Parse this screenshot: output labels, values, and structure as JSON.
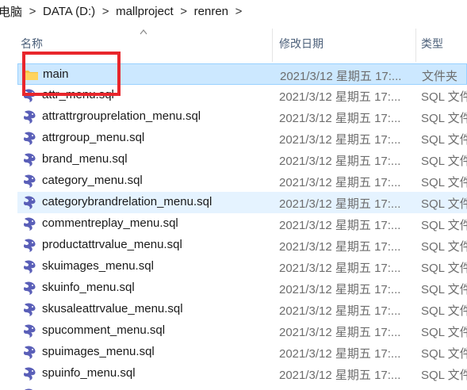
{
  "address": {
    "crumbs": [
      "电脑",
      "DATA (D:)",
      "mallproject",
      "renren"
    ],
    "separator": ">"
  },
  "columns": {
    "name": "名称",
    "date": "修改日期",
    "type": "类型"
  },
  "files": [
    {
      "name": "main",
      "date": "2021/3/12 星期五 17:...",
      "type": "文件夹",
      "icon": "folder-icon"
    },
    {
      "name": "attr_menu.sql",
      "date": "2021/3/12 星期五 17:...",
      "type": "SQL 文件",
      "icon": "sql-file-icon"
    },
    {
      "name": "attrattrgrouprelation_menu.sql",
      "date": "2021/3/12 星期五 17:...",
      "type": "SQL 文件",
      "icon": "sql-file-icon"
    },
    {
      "name": "attrgroup_menu.sql",
      "date": "2021/3/12 星期五 17:...",
      "type": "SQL 文件",
      "icon": "sql-file-icon"
    },
    {
      "name": "brand_menu.sql",
      "date": "2021/3/12 星期五 17:...",
      "type": "SQL 文件",
      "icon": "sql-file-icon"
    },
    {
      "name": "category_menu.sql",
      "date": "2021/3/12 星期五 17:...",
      "type": "SQL 文件",
      "icon": "sql-file-icon"
    },
    {
      "name": "categorybrandrelation_menu.sql",
      "date": "2021/3/12 星期五 17:...",
      "type": "SQL 文件",
      "icon": "sql-file-icon"
    },
    {
      "name": "commentreplay_menu.sql",
      "date": "2021/3/12 星期五 17:...",
      "type": "SQL 文件",
      "icon": "sql-file-icon"
    },
    {
      "name": "productattrvalue_menu.sql",
      "date": "2021/3/12 星期五 17:...",
      "type": "SQL 文件",
      "icon": "sql-file-icon"
    },
    {
      "name": "skuimages_menu.sql",
      "date": "2021/3/12 星期五 17:...",
      "type": "SQL 文件",
      "icon": "sql-file-icon"
    },
    {
      "name": "skuinfo_menu.sql",
      "date": "2021/3/12 星期五 17:...",
      "type": "SQL 文件",
      "icon": "sql-file-icon"
    },
    {
      "name": "skusaleattrvalue_menu.sql",
      "date": "2021/3/12 星期五 17:...",
      "type": "SQL 文件",
      "icon": "sql-file-icon"
    },
    {
      "name": "spucomment_menu.sql",
      "date": "2021/3/12 星期五 17:...",
      "type": "SQL 文件",
      "icon": "sql-file-icon"
    },
    {
      "name": "spuimages_menu.sql",
      "date": "2021/3/12 星期五 17:...",
      "type": "SQL 文件",
      "icon": "sql-file-icon"
    },
    {
      "name": "spuinfo_menu.sql",
      "date": "2021/3/12 星期五 17:...",
      "type": "SQL 文件",
      "icon": "sql-file-icon"
    }
  ],
  "selected_index": 0,
  "hover_index": 6,
  "colors": {
    "selection": "#cce8ff",
    "hover": "#e5f3ff",
    "annotation": "#e8262c",
    "folder": "#f5c342",
    "sql_icon": "#5a5fb8"
  }
}
